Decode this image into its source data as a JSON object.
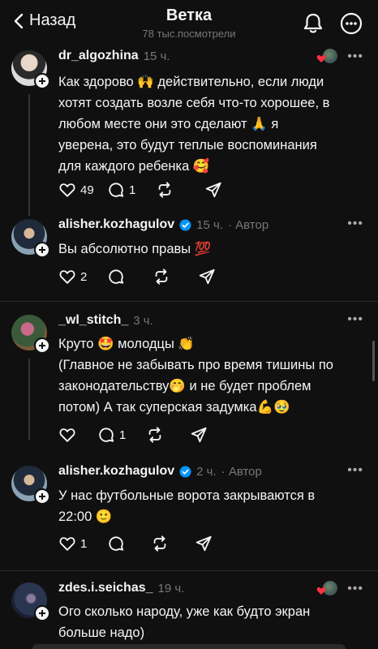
{
  "header": {
    "back_label": "Назад",
    "title": "Ветка",
    "subtitle": "78 тыс.посмотрели"
  },
  "posts": [
    {
      "username": "dr_algozhina",
      "time": "15 ч.",
      "author": "",
      "verified": false,
      "text_lines": [
        "Как здорово 🙌 действительно, если люди",
        "хотят создать возле себя что-то хорошее, в",
        "любом месте они это сделают 🙏 я",
        "уверена, это будут теплые воспоминания",
        "для каждого ребенка 🥰"
      ],
      "likes": "49",
      "replies": "1"
    },
    {
      "username": "alisher.kozhagulov",
      "time": "15 ч.",
      "author": "· Автор",
      "verified": true,
      "text_lines": [
        "Вы абсолютно правы 💯"
      ],
      "likes": "2",
      "replies": ""
    },
    {
      "username": "_wl_stitch_",
      "time": "3 ч.",
      "author": "",
      "verified": false,
      "text_lines": [
        "Круто 🤩 молодцы 👏",
        "(Главное не забывать про время тишины по",
        "законодательству🤭 и не будет проблем",
        "потом) А так суперская задумка💪🥹"
      ],
      "likes": "",
      "replies": "1"
    },
    {
      "username": "alisher.kozhagulov",
      "time": "2 ч.",
      "author": "· Автор",
      "verified": true,
      "text_lines": [
        "У нас футбольные ворота закрываются в",
        "22:00 🙂"
      ],
      "likes": "1",
      "replies": ""
    },
    {
      "username": "zdes.i.seichas_",
      "time": "19 ч.",
      "author": "",
      "verified": false,
      "text_lines": [
        "Ого сколько народу, уже как будто экран",
        "больше надо)"
      ],
      "likes": "",
      "replies": ""
    }
  ],
  "icons": {
    "back": "chevron-left-icon",
    "bell": "bell-icon",
    "more": "more-circle-icon",
    "like": "heart-icon",
    "reply": "comment-icon",
    "repost": "repost-icon",
    "share": "send-icon"
  },
  "colors": {
    "background": "#101010",
    "text": "#f3f5f7",
    "muted": "#777777",
    "verified": "#0095f6",
    "heart": "#ff3040"
  }
}
